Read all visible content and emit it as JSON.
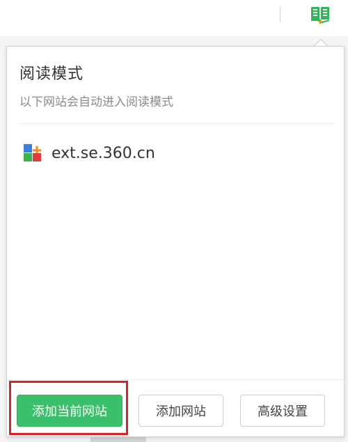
{
  "popup": {
    "title": "阅读模式",
    "subtitle": "以下网站会自动进入阅读模式",
    "sites": [
      {
        "domain": "ext.se.360.cn",
        "icon": "360-extension-icon"
      }
    ],
    "buttons": {
      "add_current": "添加当前网站",
      "add_site": "添加网站",
      "advanced": "高级设置"
    }
  },
  "toolbar": {
    "extension_icon": "reading-mode-book-icon"
  },
  "colors": {
    "accent": "#3ac06a",
    "highlight": "#e02020",
    "title_text": "#333333",
    "subtitle_text": "#8a8a8a"
  }
}
